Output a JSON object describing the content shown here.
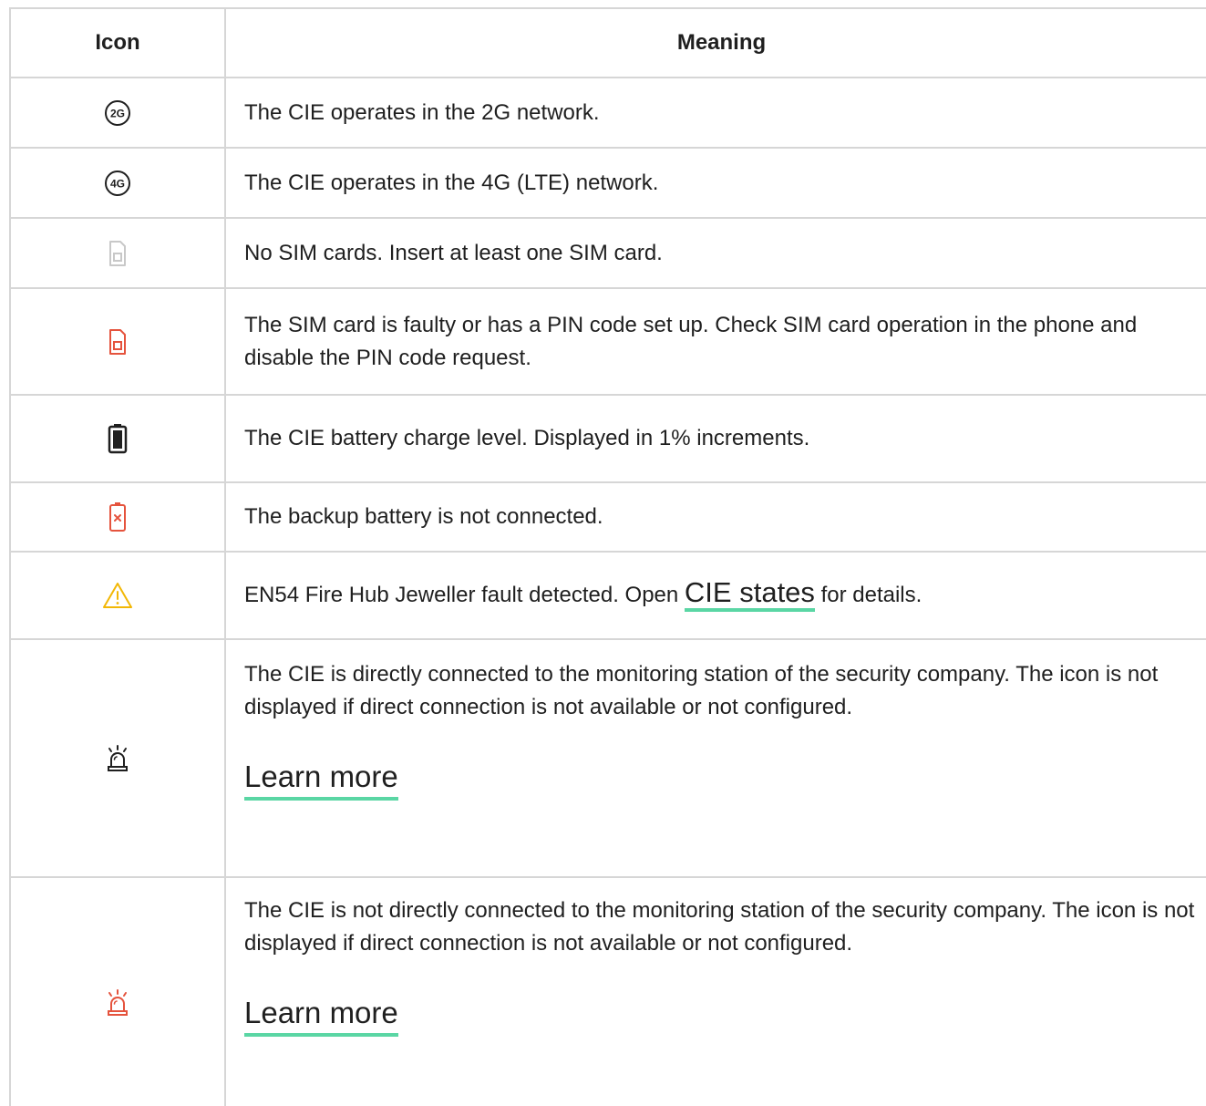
{
  "header": {
    "icon": "Icon",
    "meaning": "Meaning"
  },
  "colors": {
    "border": "#d6d6d6",
    "text": "#1f1f1f",
    "link_underline": "#5ad6a4",
    "alert_red": "#e5533d",
    "warning_yellow": "#f2b705",
    "muted_gray": "#c8c8c8"
  },
  "rows": [
    {
      "icon": "2g-network-icon",
      "text": "The CIE operates in the 2G network."
    },
    {
      "icon": "4g-network-icon",
      "text": "The CIE operates in the 4G (LTE) network."
    },
    {
      "icon": "sim-card-absent-icon",
      "text": "No SIM cards. Insert at least one SIM card."
    },
    {
      "icon": "sim-card-faulty-icon",
      "text": "The SIM card is faulty or has a PIN code set up. Check SIM card operation in the phone and disable the PIN code request."
    },
    {
      "icon": "battery-icon",
      "text": "The CIE battery charge level. Displayed in 1% increments."
    },
    {
      "icon": "battery-disconnected-icon",
      "text": "The backup battery is not connected."
    },
    {
      "icon": "warning-triangle-icon",
      "text_before": "EN54 Fire Hub Jeweller fault detected. Open ",
      "link": "CIE states",
      "text_after": " for details."
    },
    {
      "icon": "siren-connected-icon",
      "text": "The CIE is directly connected to the monitoring station of the security company. The icon is not displayed if direct connection is not available or not configured.",
      "link": "Learn more"
    },
    {
      "icon": "siren-disconnected-icon",
      "text": "The CIE is not directly connected to the monitoring station of the security company. The icon is not displayed if direct connection is not available or not configured.",
      "link": "Learn more"
    }
  ]
}
